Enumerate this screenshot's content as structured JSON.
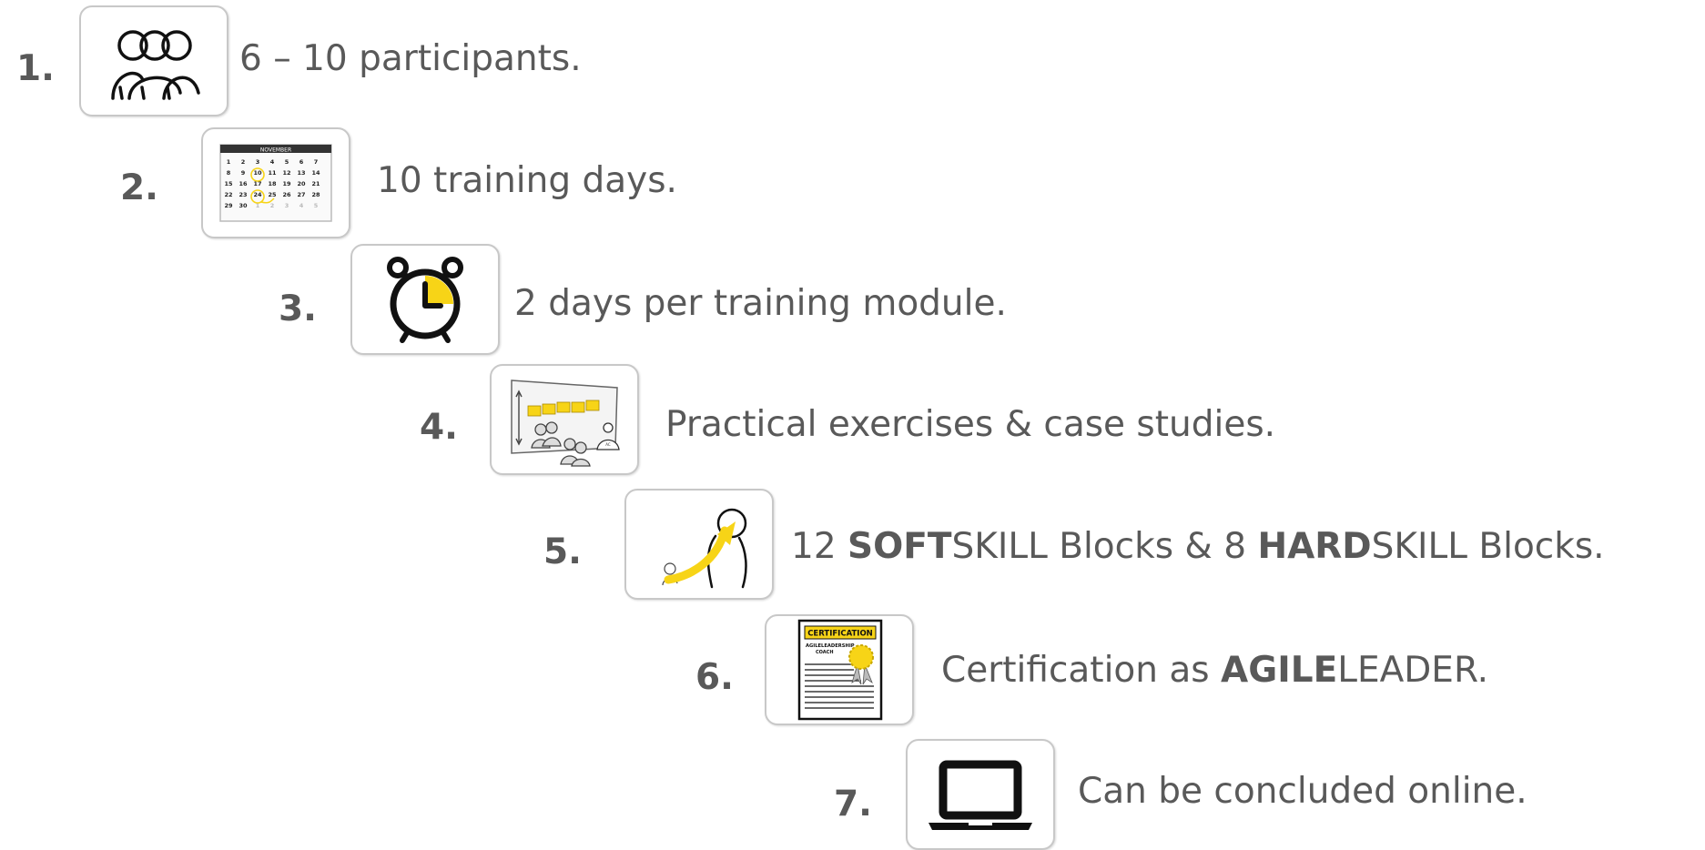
{
  "items": [
    {
      "number": "1.",
      "icon": "people-group-icon",
      "text": "6 – 10 participants."
    },
    {
      "number": "2.",
      "icon": "calendar-icon",
      "text": "10 training days.",
      "calendar": {
        "month": "NOVEMBER",
        "rows": [
          [
            "1",
            "2",
            "3",
            "4",
            "5",
            "6",
            "7"
          ],
          [
            "8",
            "9",
            "10",
            "11",
            "12",
            "13",
            "14"
          ],
          [
            "15",
            "16",
            "17",
            "18",
            "19",
            "20",
            "21"
          ],
          [
            "22",
            "23",
            "24",
            "25",
            "26",
            "27",
            "28"
          ],
          [
            "29",
            "30",
            "1",
            "2",
            "3",
            "4",
            "5"
          ]
        ]
      }
    },
    {
      "number": "3.",
      "icon": "alarm-clock-icon",
      "text": "2 days per training module."
    },
    {
      "number": "4.",
      "icon": "workshop-board-icon",
      "text": "Practical exercises & case studies."
    },
    {
      "number": "5.",
      "icon": "growth-arrow-icon",
      "text_parts": [
        "12 ",
        "SOFT",
        "SKILL Blocks & 8 ",
        "HARD",
        "SKILL Blocks."
      ]
    },
    {
      "number": "6.",
      "icon": "certificate-icon",
      "text_parts": [
        "Certification as ",
        "AGILE",
        "LEADER."
      ],
      "certificate": {
        "title": "CERTIFICATION",
        "line1": "AGILELEADERSHIP",
        "line2": "COACH"
      }
    },
    {
      "number": "7.",
      "icon": "laptop-icon",
      "text": "Can be concluded online."
    }
  ],
  "colors": {
    "text": "#595959",
    "accent": "#f7d417",
    "border": "#c8c8c8"
  }
}
